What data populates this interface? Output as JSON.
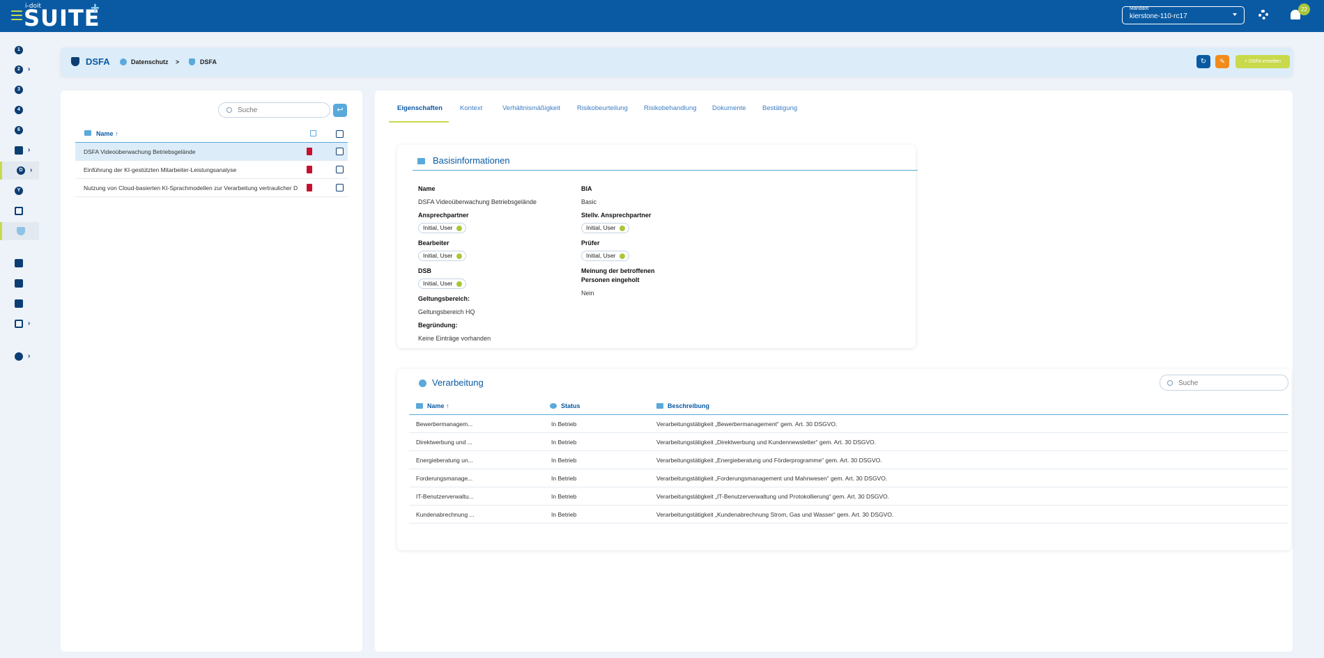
{
  "topbar": {
    "logo_small": "i-doit",
    "logo": "SUITE",
    "mandant_label": "Mandant",
    "mandant_value": "kierstone-110-rc17",
    "notification_count": "22"
  },
  "sidebar": {
    "items": [
      {
        "label": "1"
      },
      {
        "label": "2"
      },
      {
        "label": "3"
      },
      {
        "label": "4"
      },
      {
        "label": "6"
      },
      {
        "label": ""
      },
      {
        "label": "D"
      },
      {
        "label": "Y"
      },
      {
        "label": ""
      },
      {
        "label": ""
      },
      {
        "label": ""
      },
      {
        "label": ""
      },
      {
        "label": ""
      },
      {
        "label": ""
      },
      {
        "label": ""
      }
    ]
  },
  "header": {
    "title": "DSFA",
    "breadcrumb": [
      "Datenschutz",
      ">",
      "DSFA"
    ],
    "create_label": "+ DSFA erstellen"
  },
  "list": {
    "search_placeholder": "Suche",
    "column_name": "Name ↑",
    "rows": [
      {
        "name": "DSFA Videoüberwachung Betriebsgelände"
      },
      {
        "name": "Einführung der KI-gestützten Mitarbeiter-Leistungsanalyse"
      },
      {
        "name": "Nutzung von Cloud-basierten KI-Sprachmodellen zur Verarbeitung vertraulicher D"
      }
    ]
  },
  "tabs": [
    "Eigenschaften",
    "Kontext",
    "Verhältnismäßigkeit",
    "Risikobeurteilung",
    "Risikobehandlung",
    "Dokumente",
    "Bestätigung"
  ],
  "basis": {
    "title": "Basisinformationen",
    "name_label": "Name",
    "name_value": "DSFA Videoüberwachung Betriebsgelände",
    "bia_label": "BIA",
    "bia_value": "Basic",
    "ansprech_label": "Ansprechpartner",
    "ansprech_value": "Initial, User",
    "stellv_label": "Stellv. Ansprechpartner",
    "stellv_value": "Initial, User",
    "bearbeiter_label": "Bearbeiter",
    "bearbeiter_value": "Initial, User",
    "pruefer_label": "Prüfer",
    "pruefer_value": "Initial, User",
    "dsb_label": "DSB",
    "dsb_value": "Initial, User",
    "meinung_label_1": "Meinung der betroffenen",
    "meinung_label_2": "Personen eingeholt",
    "meinung_value": "Nein",
    "geltung_label": "Geltungsbereich:",
    "geltung_value": "Geltungsbereich HQ",
    "begruendung_label": "Begründung:",
    "begruendung_value": "Keine Einträge vorhanden"
  },
  "verarbeitung": {
    "title": "Verarbeitung",
    "search_placeholder": "Suche",
    "col_name": "Name ↑",
    "col_status": "Status",
    "col_desc": "Beschreibung",
    "rows": [
      {
        "name": "Bewerbermanagem...",
        "status": "In Betrieb",
        "desc": "Verarbeitungstätigkeit „Bewerbermanagement“ gem. Art. 30 DSGVO."
      },
      {
        "name": "Direktwerbung und ...",
        "status": "In Betrieb",
        "desc": "Verarbeitungstätigkeit „Direktwerbung und Kundennewsletter“ gem. Art. 30 DSGVO."
      },
      {
        "name": "Energieberatung un...",
        "status": "In Betrieb",
        "desc": "Verarbeitungstätigkeit „Energieberatung und Förderprogramme“ gem. Art. 30 DSGVO."
      },
      {
        "name": "Forderungsmanage...",
        "status": "In Betrieb",
        "desc": "Verarbeitungstätigkeit „Forderungsmanagement und Mahnwesen“ gem. Art. 30 DSGVO."
      },
      {
        "name": "IT-Benutzerverwaltu...",
        "status": "In Betrieb",
        "desc": "Verarbeitungstätigkeit „IT-Benutzerverwaltung und Protokollierung“ gem. Art. 30 DSGVO."
      },
      {
        "name": "Kundenabrechnung ...",
        "status": "In Betrieb",
        "desc": "Verarbeitungstätigkeit „Kundenabrechnung Strom, Gas und Wasser“ gem. Art. 30 DSGVO."
      }
    ]
  }
}
